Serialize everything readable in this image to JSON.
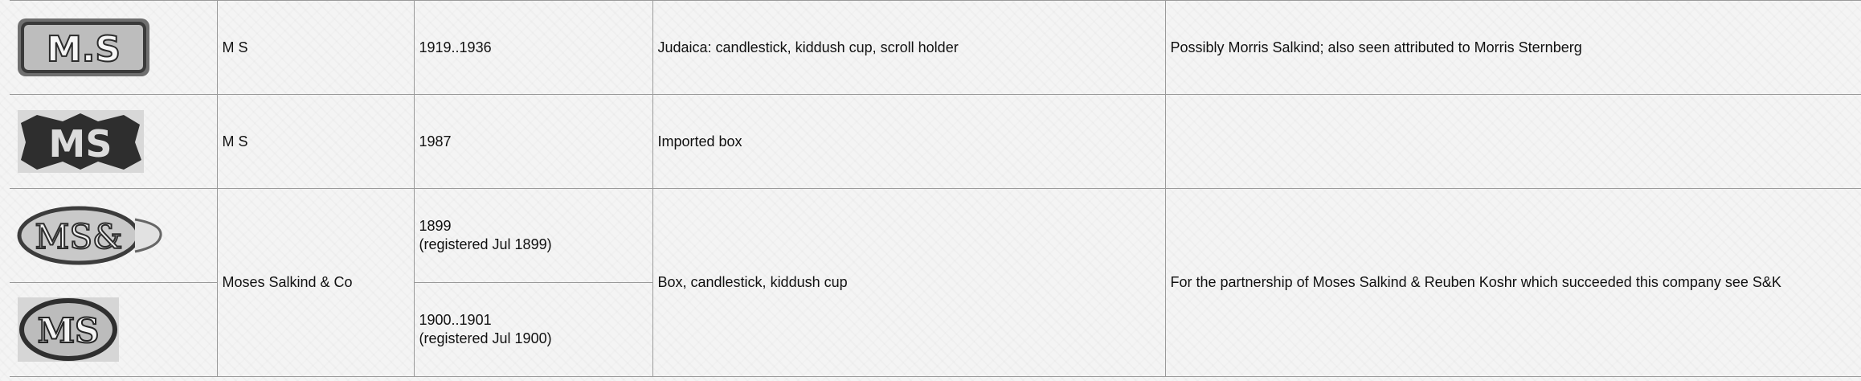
{
  "rows": [
    {
      "mark_icon": "mark-ms-rectangular",
      "maker": "M S",
      "dates": [
        "1919..1936"
      ],
      "items": "Judaica: candlestick, kiddush cup, scroll holder",
      "notes": "Possibly Morris Salkind; also seen attributed to Morris Sternberg"
    },
    {
      "mark_icon": "mark-ms-shaped",
      "maker": "M S",
      "dates": [
        "1987"
      ],
      "items": "Imported box",
      "notes": ""
    },
    {
      "maker": "Moses Salkind & Co",
      "items": "Box, candlestick, kiddush cup",
      "notes": "For the partnership of Moses Salkind & Reuben Koshr which succeeded this company see S&K",
      "sub": [
        {
          "mark_icon": "mark-ms-co-oval",
          "dates": [
            "1899",
            "(registered Jul 1899)"
          ]
        },
        {
          "mark_icon": "mark-ms-oval",
          "dates": [
            "1900..1901",
            "(registered Jul 1900)"
          ]
        }
      ]
    }
  ]
}
